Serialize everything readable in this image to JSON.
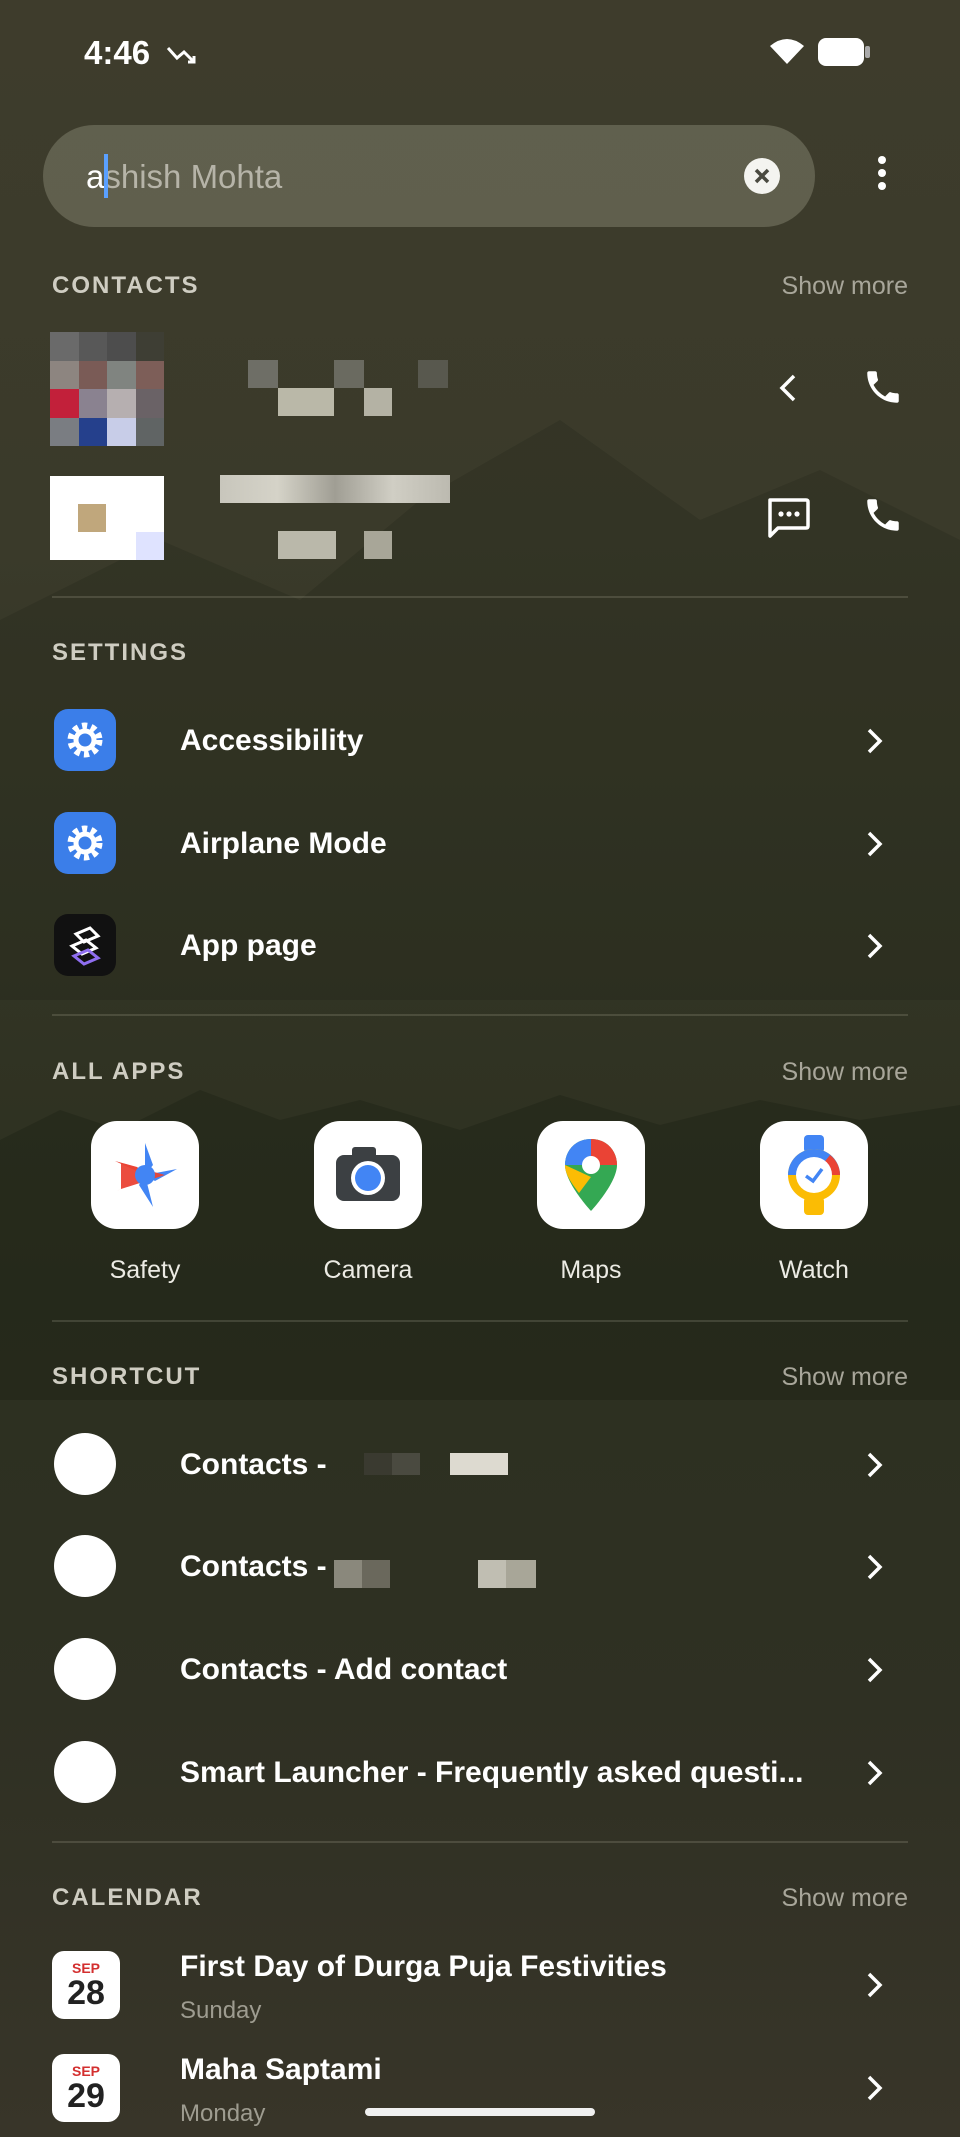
{
  "status": {
    "time": "4:46"
  },
  "search": {
    "typed": "a",
    "suggestion": "shish Mohta"
  },
  "contacts": {
    "header": "CONTACTS",
    "show_more": "Show more"
  },
  "settings": {
    "header": "SETTINGS",
    "items": [
      {
        "label": "Accessibility"
      },
      {
        "label": "Airplane Mode"
      },
      {
        "label": "App page"
      }
    ]
  },
  "apps": {
    "header": "ALL APPS",
    "show_more": "Show more",
    "items": [
      {
        "label": "Safety"
      },
      {
        "label": "Camera"
      },
      {
        "label": "Maps"
      },
      {
        "label": "Watch"
      }
    ]
  },
  "shortcut": {
    "header": "SHORTCUT",
    "show_more": "Show more",
    "items": [
      {
        "label": "Contacts -"
      },
      {
        "label": "Contacts -"
      },
      {
        "label": "Contacts - Add contact"
      },
      {
        "label": "Smart Launcher - Frequently asked questi..."
      }
    ]
  },
  "calendar": {
    "header": "CALENDAR",
    "show_more": "Show more",
    "items": [
      {
        "month": "SEP",
        "day": "28",
        "title": "First Day of Durga Puja Festivities",
        "weekday": "Sunday"
      },
      {
        "month": "SEP",
        "day": "29",
        "title": "Maha Saptami",
        "weekday": "Monday"
      }
    ]
  },
  "colors": {
    "accent_blue": "#4285f4",
    "cursor": "#5aa0ff",
    "settings_icon": "#3b7ee9"
  }
}
